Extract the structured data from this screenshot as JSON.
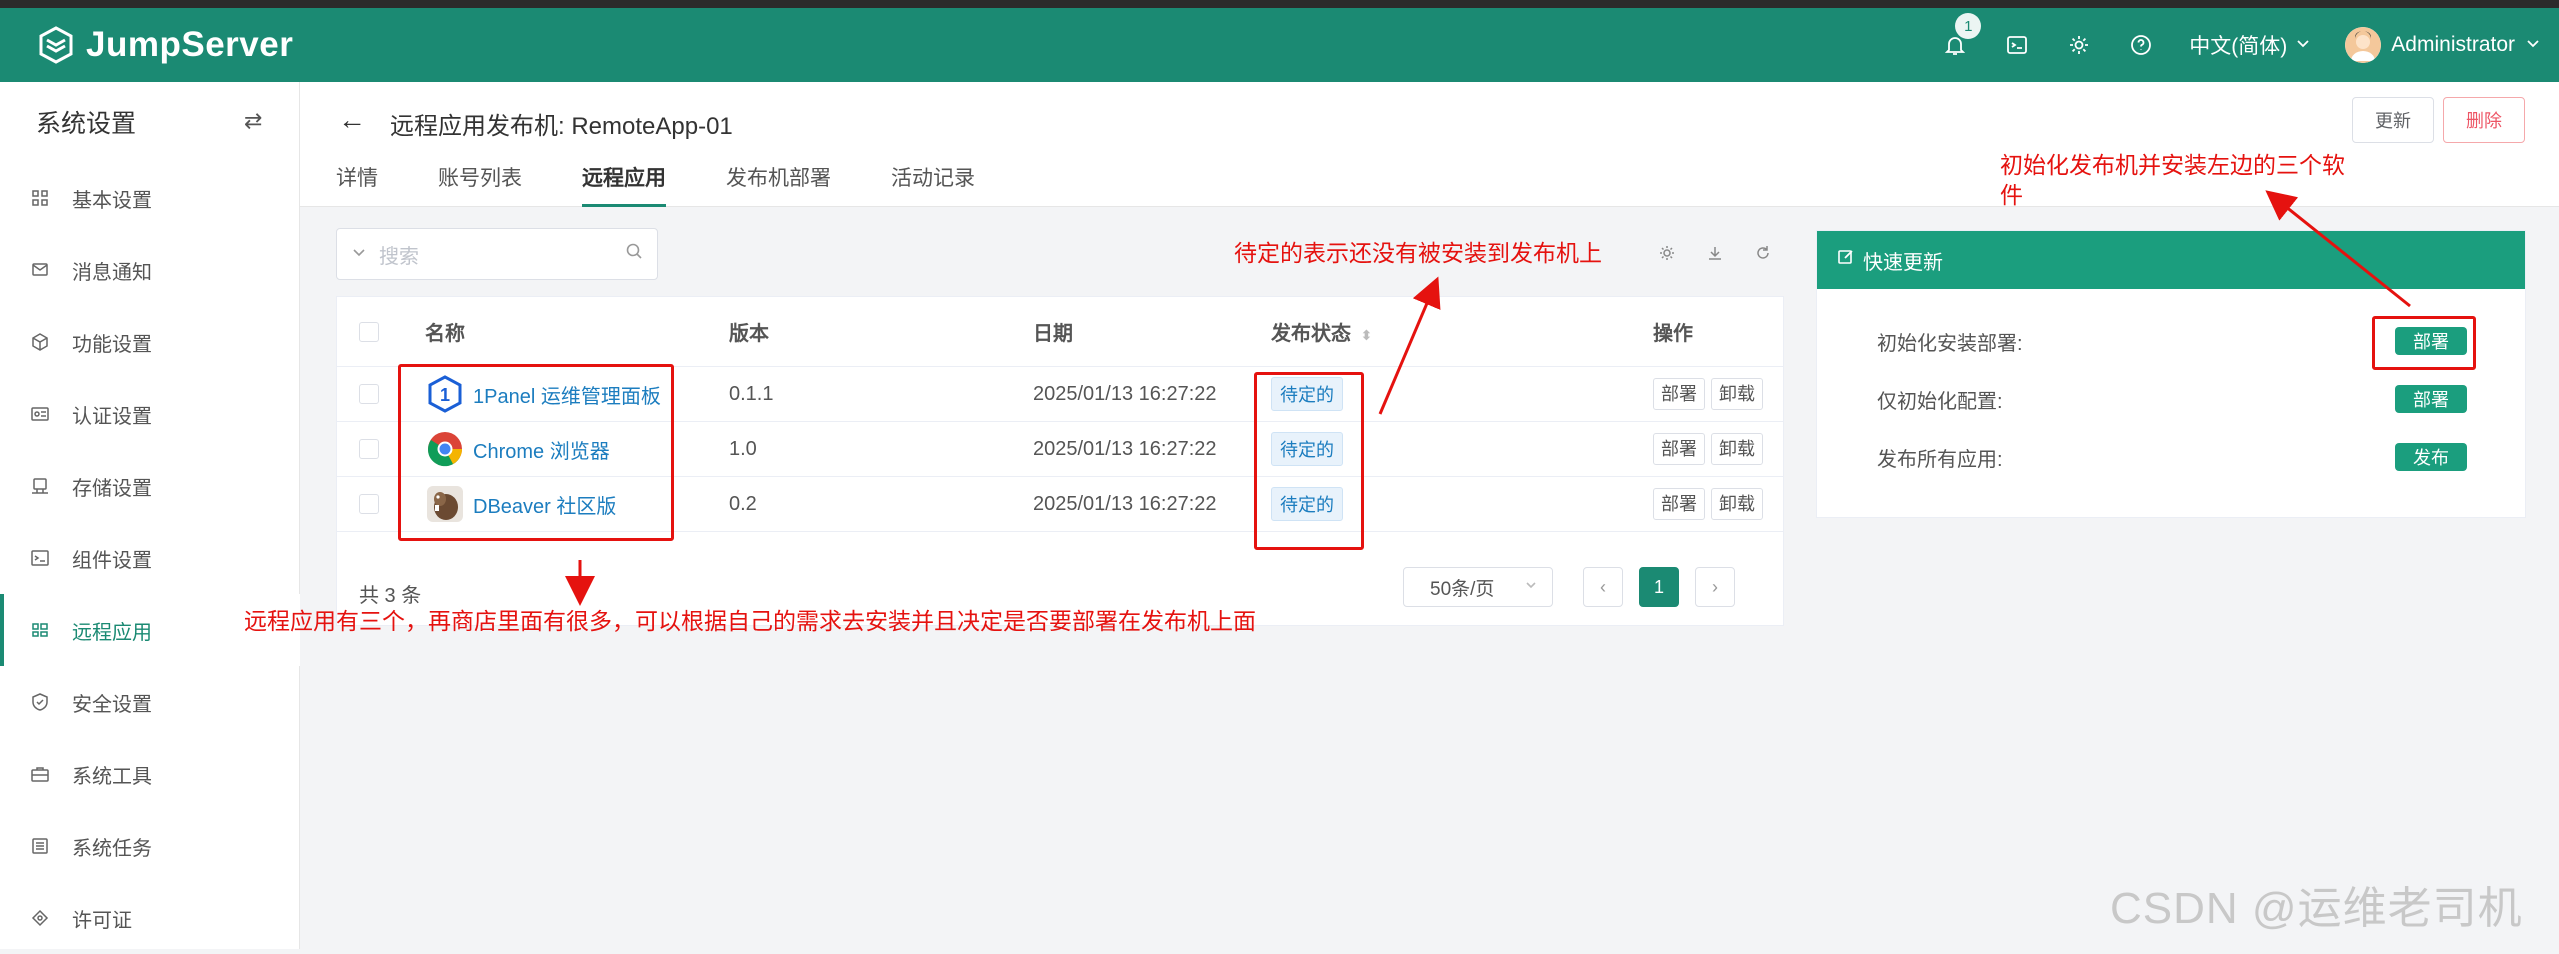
{
  "navbar": {
    "brand": "JumpServer",
    "notification_count": "1",
    "language": "中文(简体)",
    "user": "Administrator",
    "icons": [
      "bell-icon",
      "terminal-icon",
      "gear-icon",
      "help-icon"
    ]
  },
  "sidebar": {
    "title": "系统设置",
    "items": [
      {
        "label": "基本设置",
        "icon": "grid-icon"
      },
      {
        "label": "消息通知",
        "icon": "message-icon"
      },
      {
        "label": "功能设置",
        "icon": "cube-icon"
      },
      {
        "label": "认证设置",
        "icon": "id-card-icon"
      },
      {
        "label": "存储设置",
        "icon": "storage-icon"
      },
      {
        "label": "组件设置",
        "icon": "terminal-icon"
      },
      {
        "label": "远程应用",
        "icon": "apps-icon",
        "active": true
      },
      {
        "label": "安全设置",
        "icon": "shield-icon"
      },
      {
        "label": "系统工具",
        "icon": "toolbox-icon"
      },
      {
        "label": "系统任务",
        "icon": "list-icon"
      },
      {
        "label": "许可证",
        "icon": "license-icon"
      }
    ]
  },
  "header": {
    "title": "远程应用发布机: RemoteApp-01",
    "update_label": "更新",
    "delete_label": "删除",
    "tabs": [
      "详情",
      "账号列表",
      "远程应用",
      "发布机部署",
      "活动记录"
    ],
    "active_tab": "远程应用"
  },
  "list": {
    "search_placeholder": "搜索",
    "columns": [
      "名称",
      "版本",
      "日期",
      "发布状态",
      "操作"
    ],
    "rows": [
      {
        "name": "1Panel 运维管理面板",
        "version": "0.1.1",
        "date": "2025/01/13 16:27:22",
        "status": "待定的",
        "icon": "1panel-logo"
      },
      {
        "name": "Chrome 浏览器",
        "version": "1.0",
        "date": "2025/01/13 16:27:22",
        "status": "待定的",
        "icon": "chrome-logo"
      },
      {
        "name": "DBeaver 社区版",
        "version": "0.2",
        "date": "2025/01/13 16:27:22",
        "status": "待定的",
        "icon": "dbeaver-logo"
      }
    ],
    "deploy_label": "部署",
    "uninstall_label": "卸载",
    "total": "共 3 条",
    "page_size": "50条/页",
    "current_page": "1"
  },
  "quick_update": {
    "title": "快速更新",
    "items": [
      {
        "label": "初始化安装部署:",
        "button": "部署"
      },
      {
        "label": "仅初始化配置:",
        "button": "部署"
      },
      {
        "label": "发布所有应用:",
        "button": "发布"
      }
    ]
  },
  "annotations": {
    "status_note": "待定的表示还没有被安装到发布机上",
    "init_note_line1": "初始化发布机并安装左边的三个软",
    "init_note_line2": "件",
    "apps_note": "远程应用有三个，再商店里面有很多，可以根据自己的需求去安装并且决定是否要部署在发布机上面",
    "color": "#e5120f"
  },
  "watermark": "CSDN @运维老司机",
  "colors": {
    "brand": "#1b8a73",
    "link": "#1c7dbf",
    "danger": "#ed5565"
  }
}
